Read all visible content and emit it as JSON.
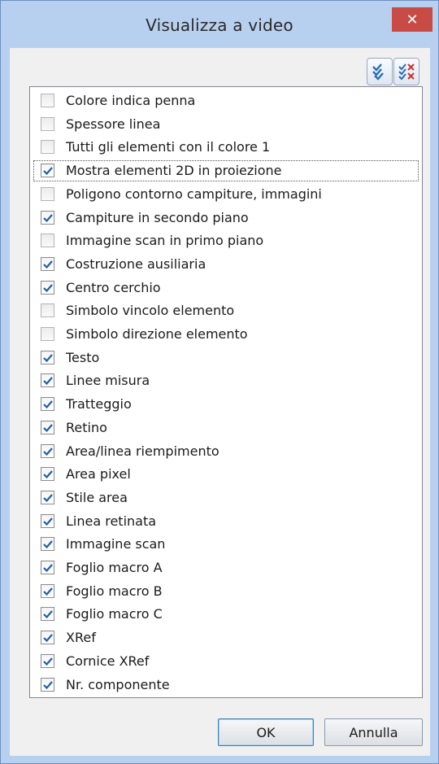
{
  "window": {
    "title": "Visualizza a video",
    "close_label": "✕"
  },
  "toolbar": {
    "check_all_icon": "check-all-icon",
    "uncheck_all_icon": "uncheck-all-icon"
  },
  "items": [
    {
      "label": "Colore indica penna",
      "checked": false
    },
    {
      "label": "Spessore linea",
      "checked": false
    },
    {
      "label": "Tutti gli elementi con il colore 1",
      "checked": false
    },
    {
      "label": "Mostra elementi 2D in proiezione",
      "checked": true,
      "focused": true
    },
    {
      "label": "Poligono contorno campiture, immagini",
      "checked": false
    },
    {
      "label": "Campiture in secondo piano",
      "checked": true
    },
    {
      "label": "Immagine scan in primo piano",
      "checked": false
    },
    {
      "label": "Costruzione ausiliaria",
      "checked": true
    },
    {
      "label": "Centro cerchio",
      "checked": true
    },
    {
      "label": "Simbolo vincolo elemento",
      "checked": false
    },
    {
      "label": "Simbolo direzione elemento",
      "checked": false
    },
    {
      "label": "Testo",
      "checked": true
    },
    {
      "label": "Linee misura",
      "checked": true
    },
    {
      "label": "Tratteggio",
      "checked": true
    },
    {
      "label": "Retino",
      "checked": true
    },
    {
      "label": "Area/linea riempimento",
      "checked": true
    },
    {
      "label": "Area pixel",
      "checked": true
    },
    {
      "label": "Stile area",
      "checked": true
    },
    {
      "label": "Linea retinata",
      "checked": true
    },
    {
      "label": "Immagine scan",
      "checked": true
    },
    {
      "label": "Foglio macro A",
      "checked": true
    },
    {
      "label": "Foglio macro B",
      "checked": true
    },
    {
      "label": "Foglio macro C",
      "checked": true
    },
    {
      "label": "XRef",
      "checked": true
    },
    {
      "label": "Cornice XRef",
      "checked": true
    },
    {
      "label": "Nr. componente",
      "checked": true
    }
  ],
  "buttons": {
    "ok_label": "OK",
    "cancel_label": "Annulla"
  },
  "colors": {
    "close_bg": "#c84b45",
    "check": "#1f5fa8",
    "frame": "#b8d0ef"
  }
}
